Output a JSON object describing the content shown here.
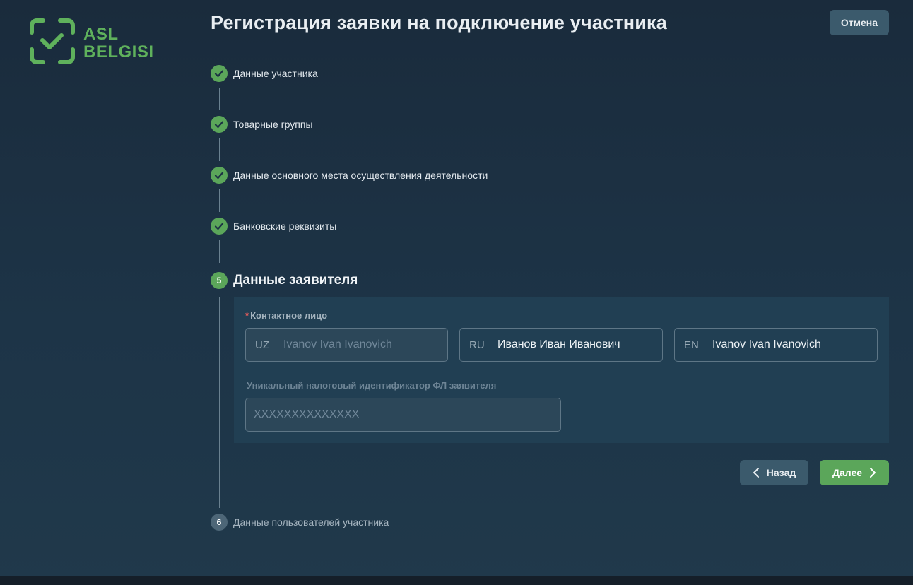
{
  "brand": {
    "line1": "ASL",
    "line2": "BELGISI",
    "color": "#5fb15c"
  },
  "header": {
    "title": "Регистрация заявки на подключение участника",
    "cancel_label": "Отмена"
  },
  "steps": [
    {
      "label": "Данные участника",
      "status": "done"
    },
    {
      "label": "Товарные группы",
      "status": "done"
    },
    {
      "label": "Данные основного места осуществления деятельности",
      "status": "done"
    },
    {
      "label": "Банковские реквизиты",
      "status": "done"
    },
    {
      "number": "5",
      "label": "Данные заявителя",
      "status": "active"
    },
    {
      "number": "6",
      "label": "Данные пользователей участника",
      "status": "pending"
    }
  ],
  "form": {
    "contact": {
      "label": "Контактное лицо",
      "required_mark": "*",
      "uz": {
        "prefix": "UZ",
        "value": "Ivanov Ivan Ivanovich"
      },
      "ru": {
        "prefix": "RU",
        "value": "Иванов Иван Иванович"
      },
      "en": {
        "prefix": "EN",
        "value": "Ivanov Ivan Ivanovich"
      }
    },
    "tax_id": {
      "label": "Уникальный налоговый идентификатор ФЛ заявителя",
      "placeholder": "XXXXXXXXXXXXXX"
    }
  },
  "nav": {
    "back_label": "Назад",
    "next_label": "Далее"
  },
  "colors": {
    "accent": "#5ba65a",
    "secondary_button": "#3b5a6c",
    "panel": "#213f53"
  }
}
